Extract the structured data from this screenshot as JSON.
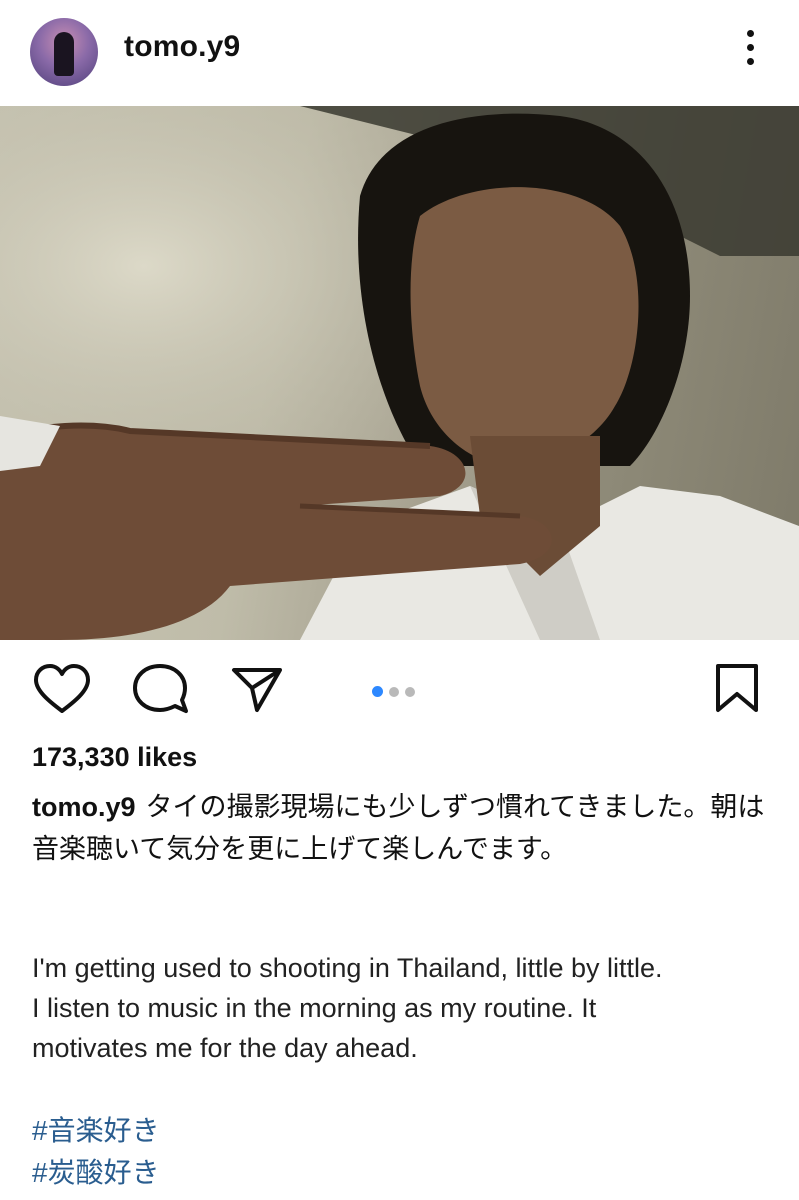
{
  "post": {
    "username": "tomo.y9",
    "likes": "173,330 likes",
    "caption_user": "tomo.y9",
    "caption_jp": "タイの撮影現場にも少しずつ慣れてきました。朝は音楽聴いて気分を更に上げて楽しんでます。",
    "caption_en_1": "I'm getting used to shooting in Thailand, little by little.",
    "caption_en_2": "I listen to music in the morning as my routine.  It",
    "caption_en_3": "motivates me for the day ahead.",
    "hashtags": [
      "#音楽好き",
      "#炭酸好き"
    ],
    "carousel": {
      "count": 3,
      "active_index": 0
    }
  },
  "icons": {
    "more": "more-options-icon",
    "like": "heart-icon",
    "comment": "comment-icon",
    "share": "send-icon",
    "save": "bookmark-icon"
  },
  "colors": {
    "hashtag": "#2a5d8f",
    "carousel_active": "#2d88ff",
    "carousel_inactive": "#b9b9b9"
  }
}
